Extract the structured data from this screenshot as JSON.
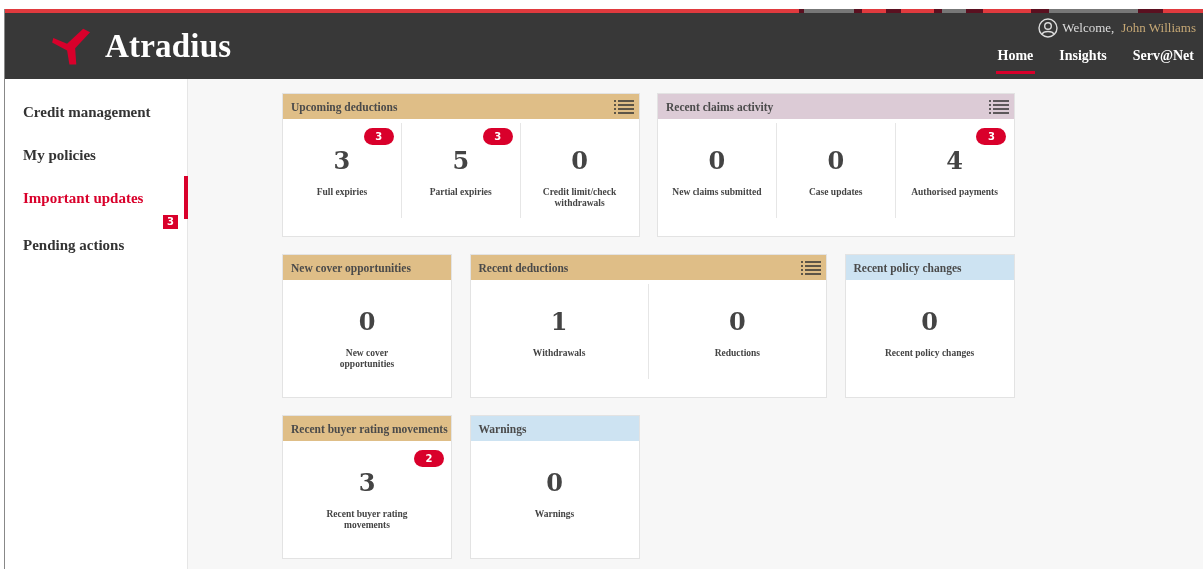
{
  "header": {
    "logo": "Atradius",
    "welcome": "Welcome,",
    "user_name": "John Williams",
    "nav": [
      {
        "label": "Home",
        "selected": true
      },
      {
        "label": "Insights",
        "selected": false
      },
      {
        "label": "Serv@Net",
        "selected": false
      }
    ]
  },
  "sidebar": {
    "items": [
      {
        "label": "Credit management",
        "selected": false
      },
      {
        "label": "My policies",
        "selected": false
      },
      {
        "label": "Important updates",
        "selected": true
      },
      {
        "label": "Pending actions",
        "selected": false,
        "badge": "3"
      }
    ]
  },
  "cards": [
    {
      "title": "Upcoming deductions",
      "color": "#dfbe87",
      "menu": true,
      "stats": [
        {
          "value": "3",
          "label": "Full expiries",
          "badge": "3"
        },
        {
          "value": "5",
          "label": "Partial expiries",
          "badge": "3"
        },
        {
          "value": "0",
          "label": "Credit limit/check withdrawals"
        }
      ]
    },
    {
      "title": "Recent claims activity",
      "color": "#dccbd6",
      "menu": true,
      "stats": [
        {
          "value": "0",
          "label": "New claims submitted"
        },
        {
          "value": "0",
          "label": "Case updates"
        },
        {
          "value": "4",
          "label": "Authorised payments",
          "badge": "3"
        }
      ]
    },
    {
      "title": "New cover opportunities",
      "color": "#dfbe87",
      "menu": false,
      "stats": [
        {
          "value": "0",
          "label": "New cover opportunities"
        }
      ]
    },
    {
      "title": "Recent deductions",
      "color": "#dfbe87",
      "menu": true,
      "stats": [
        {
          "value": "1",
          "label": "Withdrawals"
        },
        {
          "value": "0",
          "label": "Reductions"
        }
      ]
    },
    {
      "title": "Recent policy changes",
      "color": "#cde3f2",
      "menu": false,
      "stats": [
        {
          "value": "0",
          "label": "Recent policy changes"
        }
      ]
    },
    {
      "title": "Recent buyer rating movements",
      "color": "#dfbe87",
      "menu": false,
      "stats": [
        {
          "value": "3",
          "label": "Recent buyer rating movements",
          "badge": "2"
        }
      ]
    },
    {
      "title": "Warnings",
      "color": "#cde3f2",
      "menu": false,
      "stats": [
        {
          "value": "0",
          "label": "Warnings"
        }
      ]
    }
  ]
}
